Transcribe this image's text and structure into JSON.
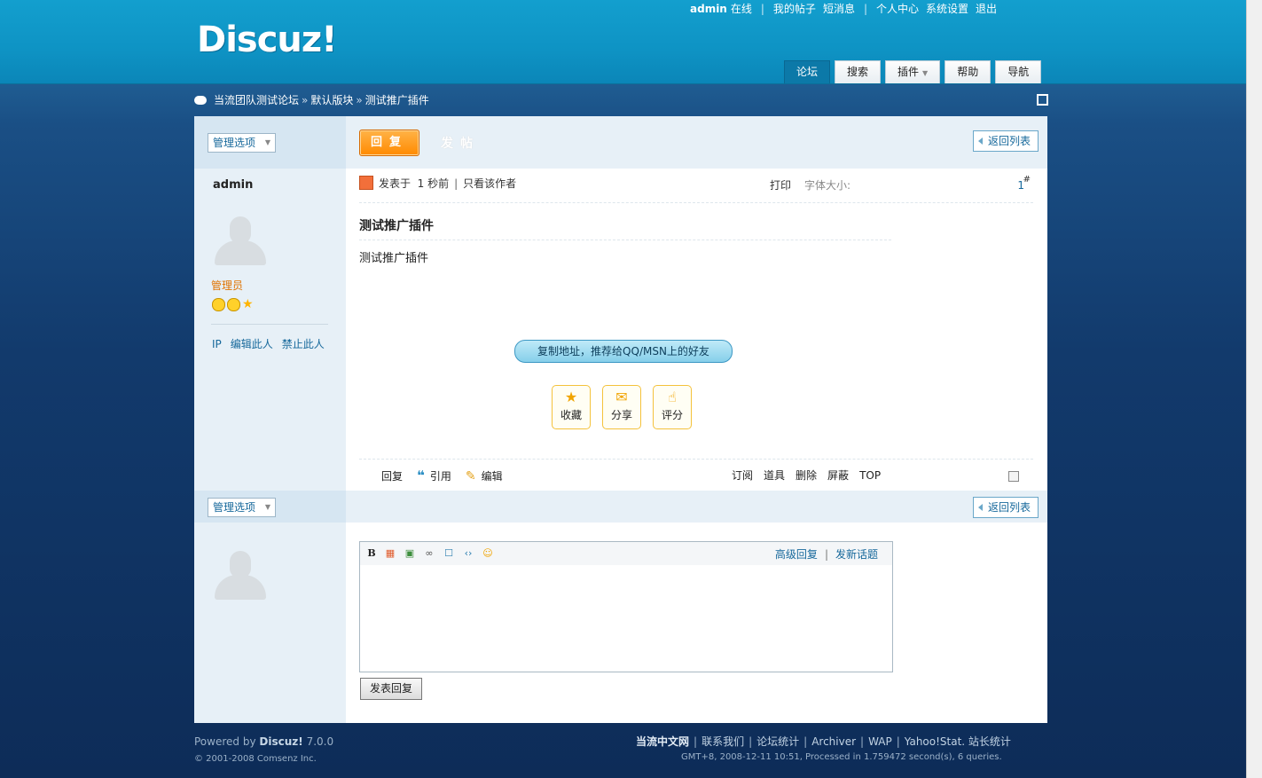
{
  "header": {
    "logo": "Discuz!",
    "user": {
      "name": "admin",
      "status": "在线",
      "links": [
        "我的帖子",
        "短消息",
        "个人中心",
        "系统设置",
        "退出"
      ]
    },
    "tabs": [
      {
        "label": "论坛",
        "active": true
      },
      {
        "label": "搜索"
      },
      {
        "label": "插件",
        "dropdown": true
      },
      {
        "label": "帮助"
      },
      {
        "label": "导航"
      }
    ]
  },
  "breadcrumb": [
    "当流团队测试论坛",
    "默认版块",
    "测试推广插件"
  ],
  "toolbar": {
    "manage_label": "管理选项",
    "reply_label": "回复",
    "new_post_label": "发帖",
    "back_to_list": "返回列表"
  },
  "post": {
    "author": "admin",
    "role": "管理员",
    "side_links": [
      "IP",
      "编辑此人",
      "禁止此人"
    ],
    "posted_prefix": "发表于",
    "posted_time": "1 秒前",
    "only_author": "只看该作者",
    "print": "打印",
    "font_size": "字体大小:",
    "floor": "1",
    "floor_mark": "#",
    "title": "测试推广插件",
    "body": "测试推广插件",
    "copy_button": "复制地址，推荐给QQ/MSN上的好友",
    "actions": [
      "收藏",
      "分享",
      "评分"
    ],
    "ops_left": [
      "回复",
      "引用",
      "编辑"
    ],
    "ops_right": [
      "订阅",
      "道具",
      "删除",
      "屏蔽",
      "TOP"
    ]
  },
  "quick_reply": {
    "manage_label": "管理选项",
    "back_to_list": "返回列表",
    "bold_glyph": "B",
    "advanced": "高级回复",
    "new_topic": "发新话题",
    "submit": "发表回复"
  },
  "footer": {
    "powered_prefix": "Powered by",
    "powered_name": "Discuz!",
    "version": "7.0.0",
    "copyright": "© 2001-2008 Comsenz Inc.",
    "site": "当流中文网",
    "links": [
      "联系我们",
      "论坛统计",
      "Archiver",
      "WAP",
      "Yahoo!Stat. 站长统计"
    ],
    "stats": "GMT+8, 2008-12-11 10:51, Processed in 1.759472 second(s), 6 queries."
  }
}
